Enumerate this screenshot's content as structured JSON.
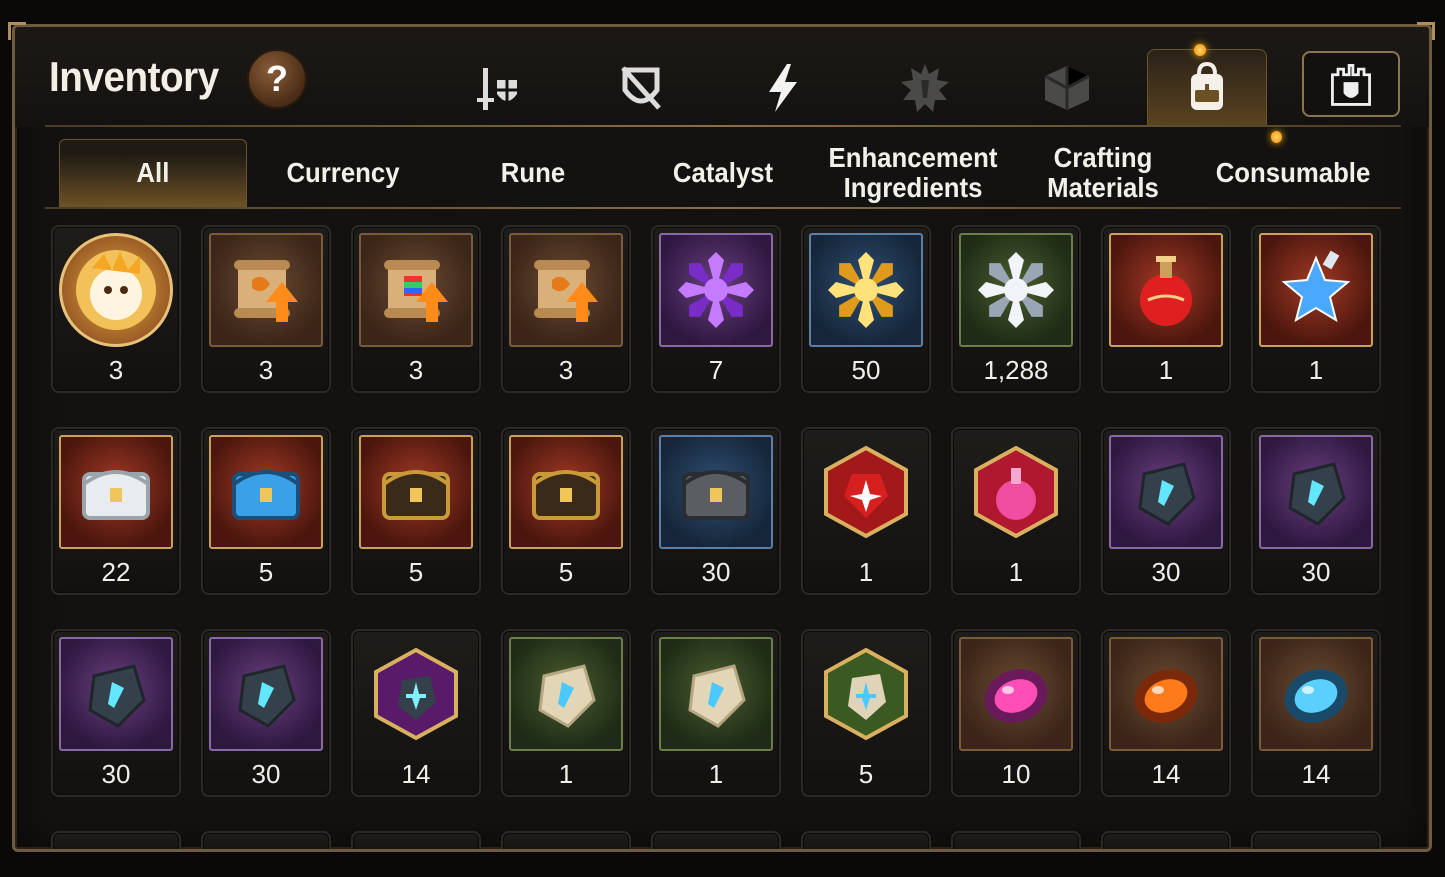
{
  "window": {
    "title": "Inventory",
    "help_label": "?"
  },
  "category_tabs": [
    {
      "name": "equipment-tab",
      "icon": "sword-shield-icon",
      "active": false
    },
    {
      "name": "gear-disabled-tab",
      "icon": "crossed-shield-icon",
      "active": false
    },
    {
      "name": "skill-tab",
      "icon": "lightning-icon",
      "active": false
    },
    {
      "name": "badge-tab",
      "icon": "spiked-emblem-icon",
      "active": false
    },
    {
      "name": "box-tab",
      "icon": "cube-icon",
      "active": false
    },
    {
      "name": "bag-tab",
      "icon": "backpack-icon",
      "active": true,
      "notification": true
    }
  ],
  "guild_button": {
    "icon": "castle-shield-icon"
  },
  "subtabs": [
    {
      "label": "All",
      "active": true
    },
    {
      "label": "Currency"
    },
    {
      "label": "Rune"
    },
    {
      "label": "Catalyst"
    },
    {
      "label": "Enhancement\nIngredients"
    },
    {
      "label": "Crafting\nMaterials"
    },
    {
      "label": "Consumable",
      "notification": true
    }
  ],
  "items": [
    {
      "icon": "hero-portrait-icon",
      "bg": "hero",
      "qty": "3"
    },
    {
      "icon": "scroll-upgrade-icon",
      "bg": "brown",
      "qty": "3"
    },
    {
      "icon": "rainbow-scroll-upgrade-icon",
      "bg": "brown",
      "qty": "3"
    },
    {
      "icon": "scroll-upgrade-icon",
      "bg": "brown",
      "qty": "3"
    },
    {
      "icon": "purple-crystal-flower-icon",
      "bg": "purple",
      "qty": "7"
    },
    {
      "icon": "gold-crystal-flower-icon",
      "bg": "blue",
      "qty": "50"
    },
    {
      "icon": "silver-crystal-flower-icon",
      "bg": "green",
      "qty": "1,288"
    },
    {
      "icon": "red-potion-icon",
      "bg": "red",
      "qty": "1"
    },
    {
      "icon": "star-potion-icon",
      "bg": "red",
      "qty": "1"
    },
    {
      "icon": "silver-chest-icon",
      "bg": "red",
      "qty": "22"
    },
    {
      "icon": "blue-chest-icon",
      "bg": "red",
      "qty": "5"
    },
    {
      "icon": "gold-chest-icon",
      "bg": "red",
      "qty": "5"
    },
    {
      "icon": "gold-chest-icon",
      "bg": "red",
      "qty": "5"
    },
    {
      "icon": "iron-box-icon",
      "bg": "blue",
      "qty": "30"
    },
    {
      "icon": "red-rune-hex-icon",
      "bg": "hex-red",
      "qty": "1"
    },
    {
      "icon": "pink-potion-hex-icon",
      "bg": "hex-red",
      "qty": "1"
    },
    {
      "icon": "sword-rune-stone-icon",
      "bg": "purple",
      "qty": "30"
    },
    {
      "icon": "swirl-rune-stone-icon",
      "bg": "purple",
      "qty": "30"
    },
    {
      "icon": "armor-rune-stone-icon",
      "bg": "purple",
      "qty": "30"
    },
    {
      "icon": "boot-rune-stone-icon",
      "bg": "purple",
      "qty": "30"
    },
    {
      "icon": "star-rune-hex-icon",
      "bg": "hex-purple",
      "qty": "14"
    },
    {
      "icon": "sword-rune-tablet-icon",
      "bg": "green",
      "qty": "1"
    },
    {
      "icon": "swirl-rune-tablet-icon",
      "bg": "green",
      "qty": "1"
    },
    {
      "icon": "star-rune-tablet-hex-icon",
      "bg": "hex-green",
      "qty": "5"
    },
    {
      "icon": "pink-gem-icon",
      "bg": "brown",
      "qty": "10"
    },
    {
      "icon": "orange-gem-icon",
      "bg": "brown",
      "qty": "14"
    },
    {
      "icon": "blue-gem-icon",
      "bg": "brown",
      "qty": "14"
    }
  ],
  "colors": {
    "frame": "#6e5b3e",
    "accent": "#b08d5a",
    "active_tab": "#6d5126",
    "notify": "#ffb300"
  }
}
